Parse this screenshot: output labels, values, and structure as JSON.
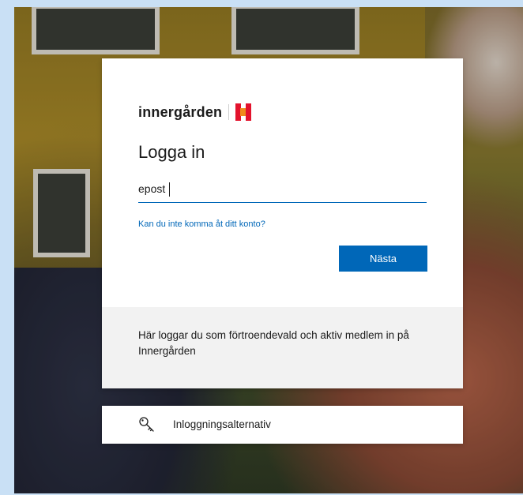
{
  "brand": {
    "name": "innergården",
    "colors": {
      "logo_red": "#e3132d",
      "logo_orange": "#f08a1c"
    }
  },
  "signin": {
    "title": "Logga in",
    "email_value": "epost",
    "email_placeholder": "",
    "help_link": "Kan du inte komma åt ditt konto?",
    "next_button": "Nästa"
  },
  "info": {
    "text": "Här loggar du som förtroendevald och aktiv medlem in på Innergården"
  },
  "options": {
    "label": "Inloggningsalternativ",
    "icon": "key-icon"
  },
  "theme": {
    "accent": "#0067b8",
    "page_background": "#c9e0f5"
  }
}
